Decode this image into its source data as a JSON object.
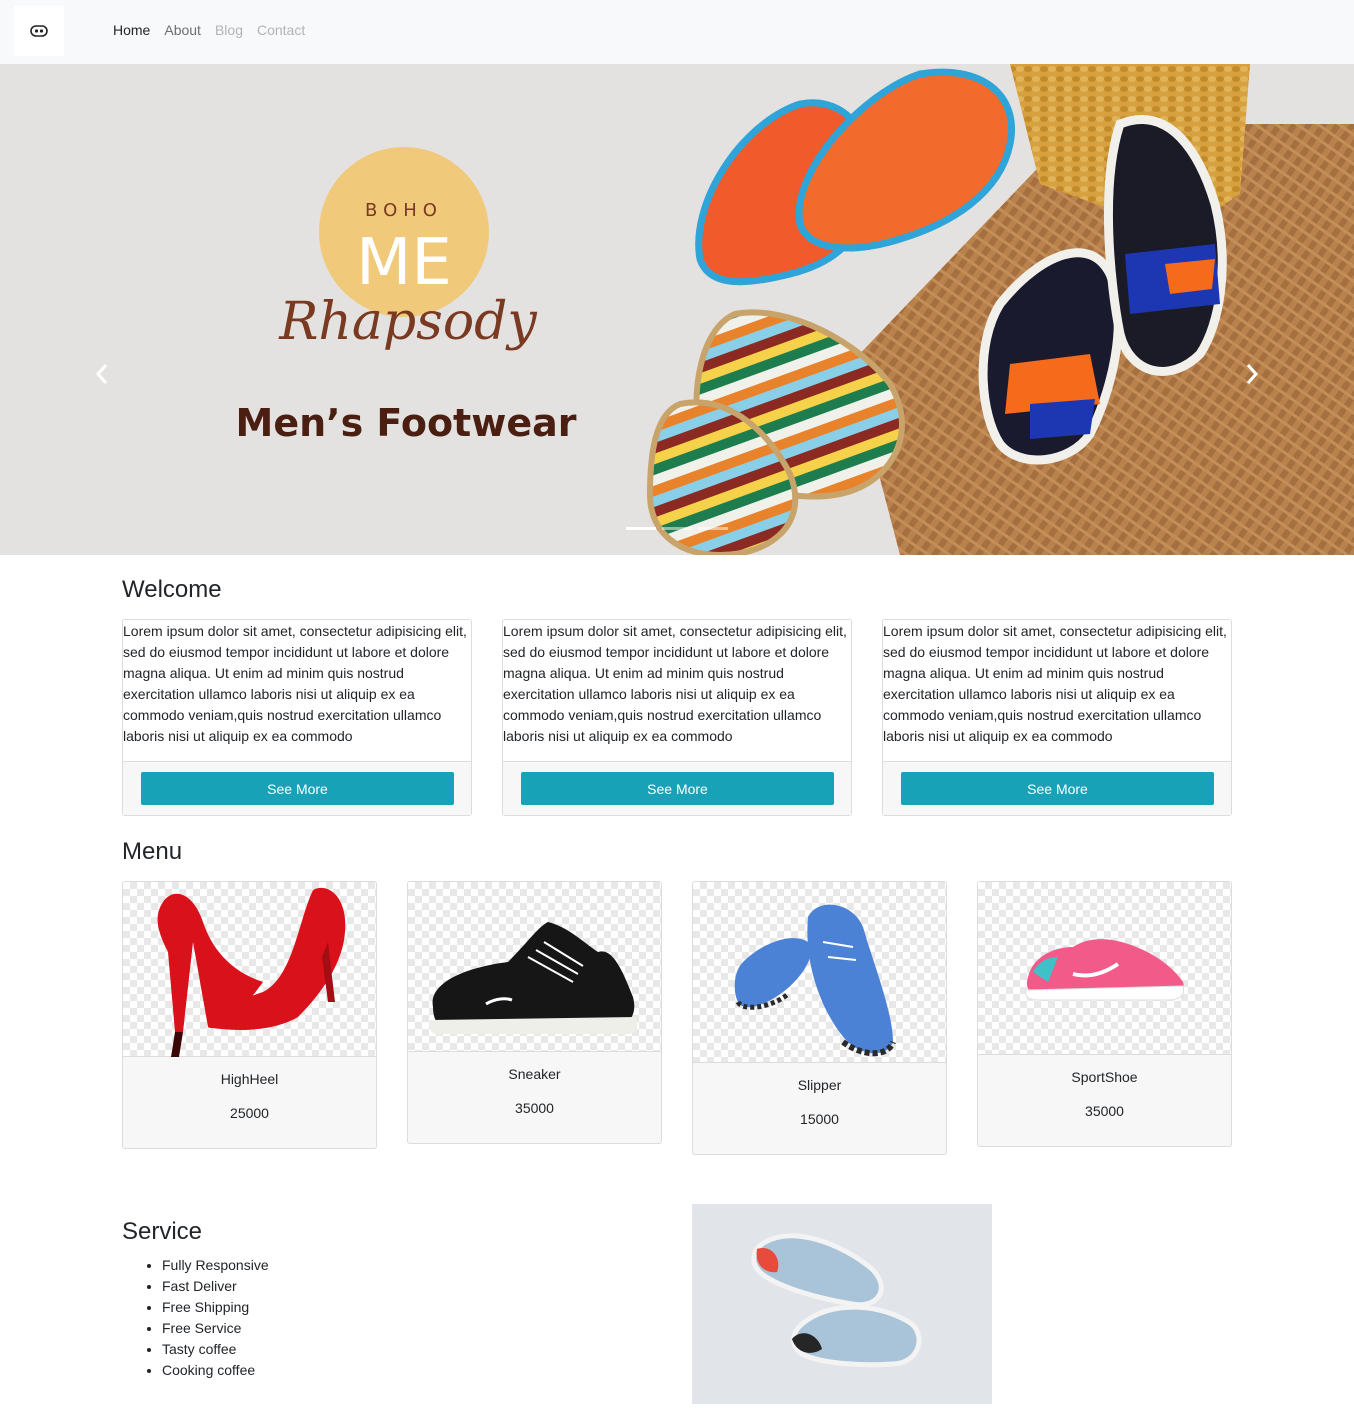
{
  "navbar": {
    "brand_icon": "brand-logo-icon",
    "links": [
      {
        "label": "Home",
        "state": "active"
      },
      {
        "label": "About",
        "state": "normal"
      },
      {
        "label": "Blog",
        "state": "muted"
      },
      {
        "label": "Contact",
        "state": "muted"
      }
    ]
  },
  "carousel": {
    "logo_top": "BOHO",
    "logo_me": "ME",
    "logo_script": "Rhapsody",
    "tagline": "Men’s Footwear",
    "prev_icon": "chevron-left-icon",
    "next_icon": "chevron-right-icon",
    "active_slide": 1,
    "slide_count": 3
  },
  "welcome": {
    "title": "Welcome",
    "cards": [
      {
        "text": "Lorem ipsum dolor sit amet, consectetur adipisicing elit, sed do eiusmod tempor incididunt ut labore et dolore magna aliqua. Ut enim ad minim quis nostrud exercitation ullamco laboris nisi ut aliquip ex ea commodo veniam,quis nostrud exercitation ullamco laboris nisi ut aliquip ex ea commodo",
        "button": "See More"
      },
      {
        "text": "Lorem ipsum dolor sit amet, consectetur adipisicing elit, sed do eiusmod tempor incididunt ut labore et dolore magna aliqua. Ut enim ad minim quis nostrud exercitation ullamco laboris nisi ut aliquip ex ea commodo veniam,quis nostrud exercitation ullamco laboris nisi ut aliquip ex ea commodo",
        "button": "See More"
      },
      {
        "text": "Lorem ipsum dolor sit amet, consectetur adipisicing elit, sed do eiusmod tempor incididunt ut labore et dolore magna aliqua. Ut enim ad minim quis nostrud exercitation ullamco laboris nisi ut aliquip ex ea commodo veniam,quis nostrud exercitation ullamco laboris nisi ut aliquip ex ea commodo",
        "button": "See More"
      }
    ]
  },
  "menu": {
    "title": "Menu",
    "items": [
      {
        "name": "HighHeel",
        "price": "25000",
        "icon": "high-heel-icon"
      },
      {
        "name": "Sneaker",
        "price": "35000",
        "icon": "sneaker-icon"
      },
      {
        "name": "Slipper",
        "price": "15000",
        "icon": "slipper-icon"
      },
      {
        "name": "SportShoe",
        "price": "35000",
        "icon": "sport-shoe-icon"
      }
    ]
  },
  "service": {
    "title": "Service",
    "items": [
      "Fully Responsive",
      "Fast Deliver",
      "Free Shipping",
      "Free Service",
      "Tasty coffee",
      "Cooking coffee"
    ],
    "photo_icon": "running-shoes-photo"
  },
  "colors": {
    "accent": "#17a2b8",
    "navbar_bg": "#f8f9fa",
    "logo_circle": "#f0c97a",
    "logo_script": "#7a3a22",
    "tagline": "#4a1f12"
  }
}
